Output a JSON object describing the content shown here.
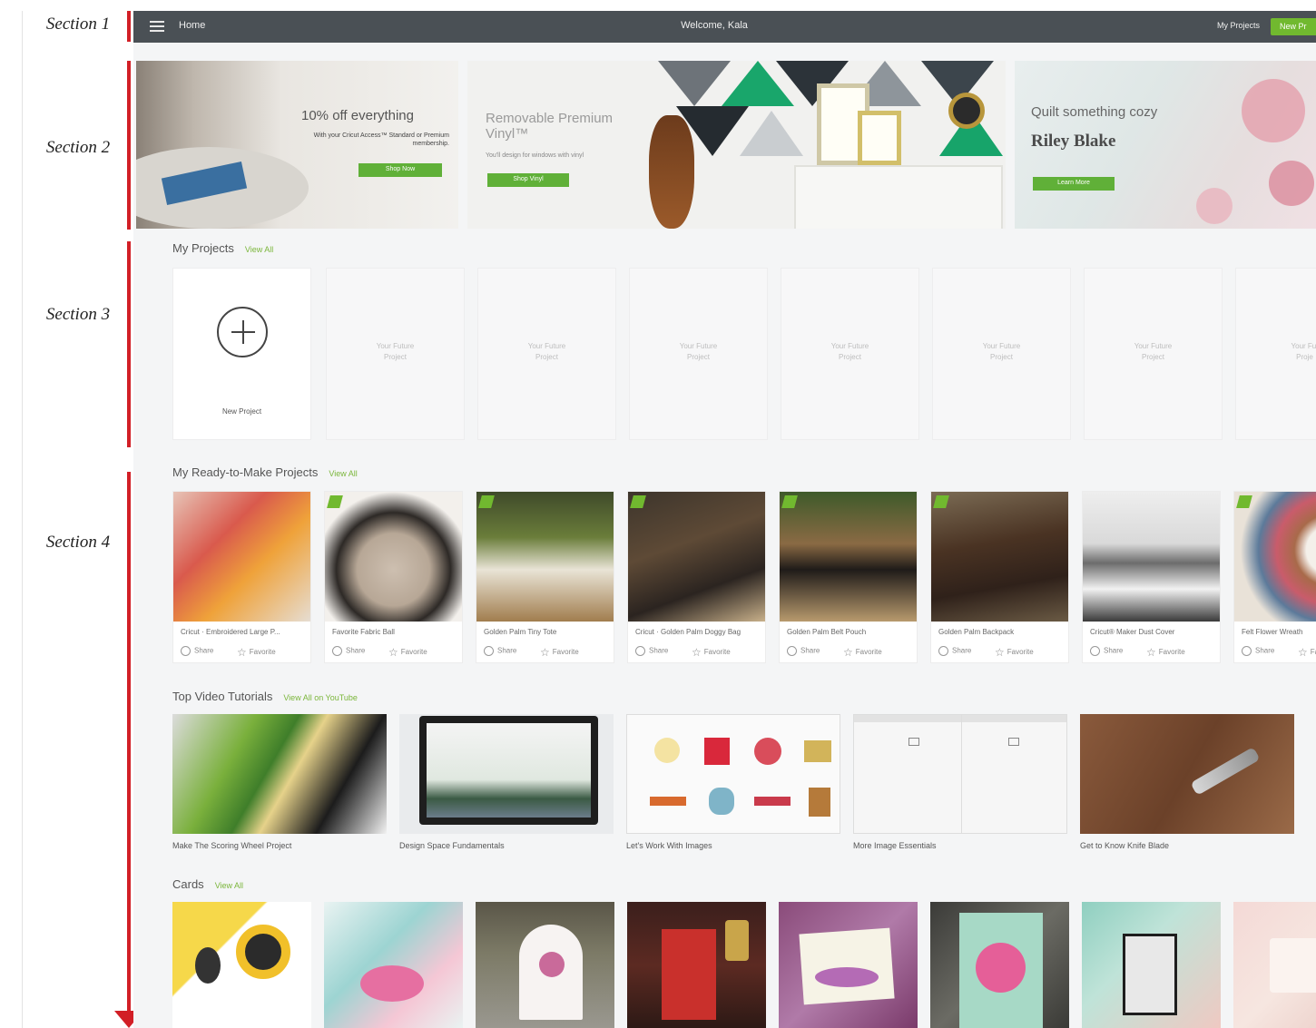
{
  "annotations": {
    "section1": "Section 1",
    "section2": "Section 2",
    "section3": "Section 3",
    "section4": "Section 4"
  },
  "nav": {
    "home": "Home",
    "welcome": "Welcome, Kala",
    "my_projects": "My Projects",
    "new_project": "New Pr"
  },
  "banners": [
    {
      "headline": "10% off everything",
      "sub": "With your Cricut Access™ Standard or Premium membership.",
      "button": "Shop Now"
    },
    {
      "headline": "Removable Premium Vinyl™",
      "sub": "You'll design for windows with vinyl",
      "button": "Shop Vinyl"
    },
    {
      "headline": "Quilt something cozy",
      "brand": "Riley Blake",
      "button": "Learn More"
    }
  ],
  "my_projects": {
    "title": "My Projects",
    "view_all": "View All",
    "new_label": "New Project",
    "placeholders": [
      "Your Future Project",
      "Your Future Project",
      "Your Future Project",
      "Your Future Project",
      "Your Future Project",
      "Your Future Project",
      "Your Fut Proje"
    ]
  },
  "ready_to_make": {
    "title": "My Ready-to-Make Projects",
    "view_all": "View All",
    "share": "Share",
    "favorite": "Favorite",
    "items": [
      {
        "title": "Cricut · Embroidered Large P..."
      },
      {
        "title": "Favorite Fabric Ball"
      },
      {
        "title": "Golden Palm Tiny Tote"
      },
      {
        "title": "Cricut · Golden Palm Doggy Bag"
      },
      {
        "title": "Golden Palm Belt Pouch"
      },
      {
        "title": "Golden Palm Backpack"
      },
      {
        "title": "Cricut® Maker Dust Cover"
      },
      {
        "title": "Felt Flower Wreath"
      }
    ]
  },
  "video_tutorials": {
    "title": "Top Video Tutorials",
    "view_all": "View All on YouTube",
    "items": [
      {
        "title": "Make The Scoring Wheel Project"
      },
      {
        "title": "Design Space Fundamentals"
      },
      {
        "title": "Let's Work With Images"
      },
      {
        "title": "More Image Essentials"
      },
      {
        "title": "Get to Know Knife Blade"
      }
    ]
  },
  "cards": {
    "title": "Cards",
    "view_all": "View All"
  },
  "colors": {
    "accent_green": "#71b92f",
    "nav_bg": "#4a5055",
    "annotation_red": "#d21f26"
  }
}
